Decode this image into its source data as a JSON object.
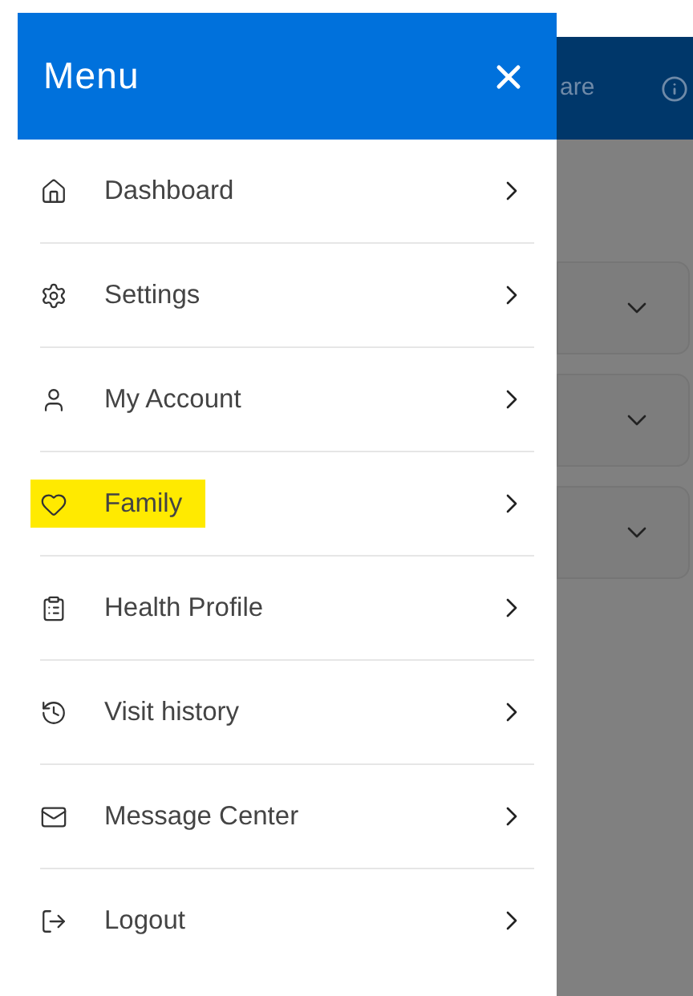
{
  "background": {
    "header_text": "are"
  },
  "menu": {
    "title": "Menu",
    "items": [
      {
        "label": "Dashboard",
        "highlighted": false
      },
      {
        "label": "Settings",
        "highlighted": false
      },
      {
        "label": "My Account",
        "highlighted": false
      },
      {
        "label": "Family",
        "highlighted": true
      },
      {
        "label": "Health Profile",
        "highlighted": false
      },
      {
        "label": "Visit history",
        "highlighted": false
      },
      {
        "label": "Message Center",
        "highlighted": false
      },
      {
        "label": "Logout",
        "highlighted": false
      }
    ]
  }
}
